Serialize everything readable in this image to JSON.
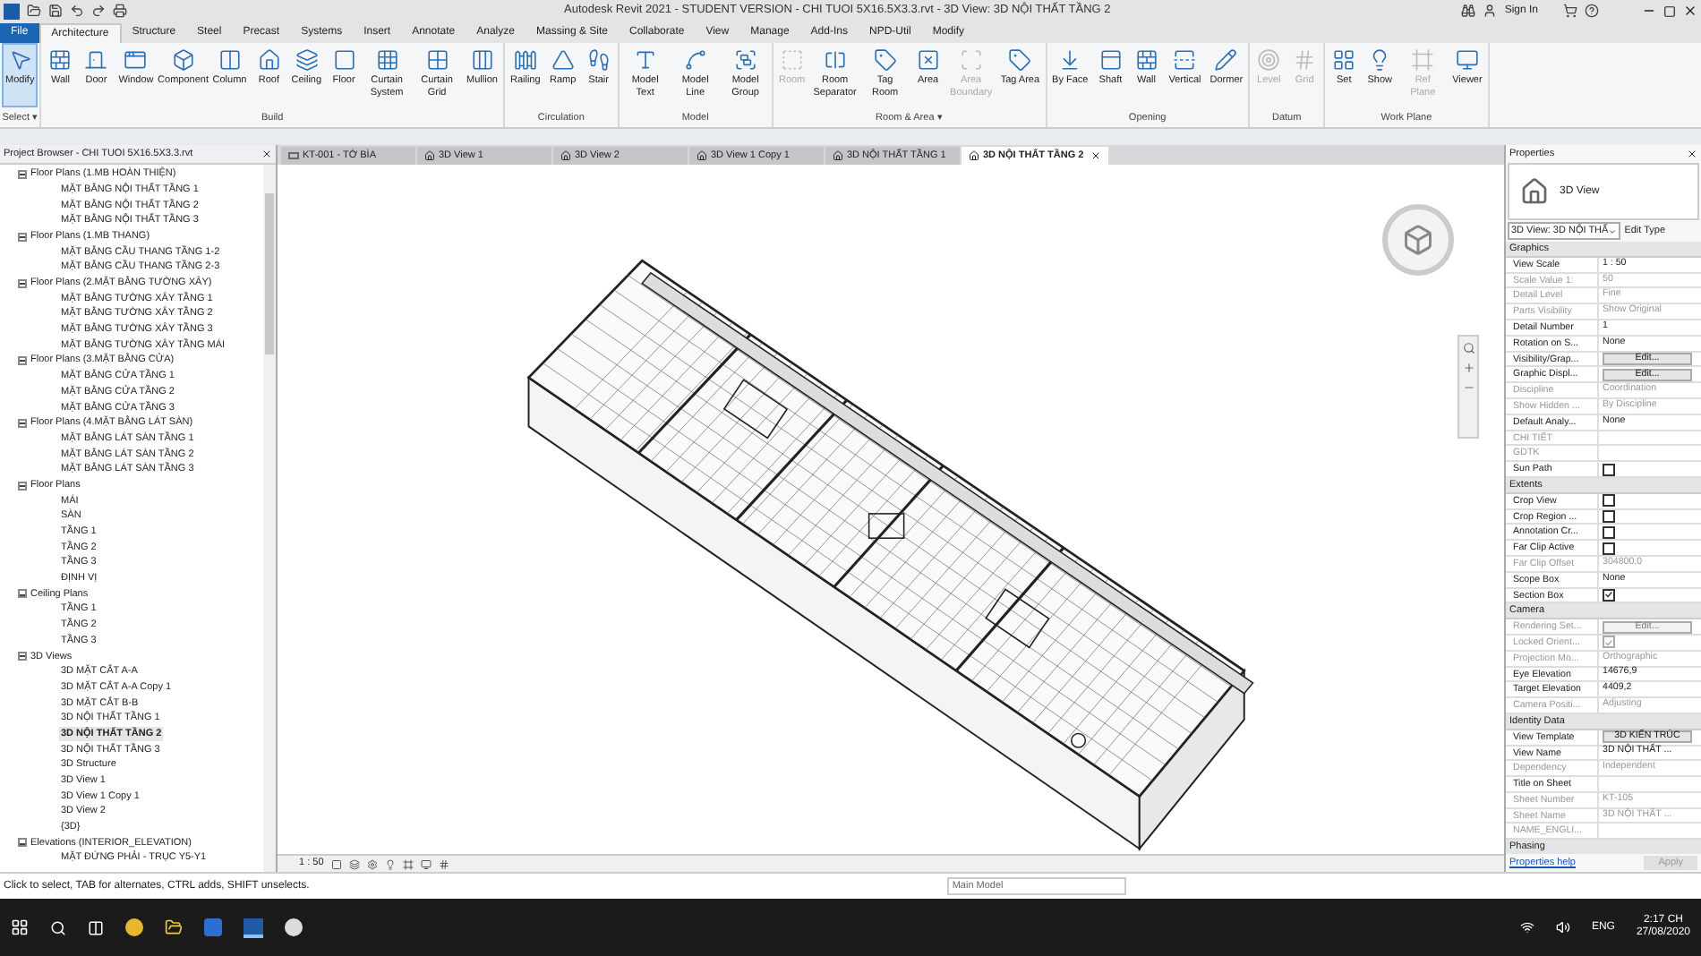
{
  "title_bar": {
    "title": "Autodesk Revit 2021 - STUDENT VERSION - CHI TUOI 5X16.5X3.3.rvt - 3D View: 3D NỘI THẤT TẦNG 2",
    "sign_in": "Sign In"
  },
  "file_tab": "File",
  "ribbon_tabs": [
    {
      "label": "Architecture",
      "selected": true
    },
    {
      "label": "Structure",
      "selected": false
    },
    {
      "label": "Steel",
      "selected": false
    },
    {
      "label": "Precast",
      "selected": false
    },
    {
      "label": "Systems",
      "selected": false
    },
    {
      "label": "Insert",
      "selected": false
    },
    {
      "label": "Annotate",
      "selected": false
    },
    {
      "label": "Analyze",
      "selected": false
    },
    {
      "label": "Massing & Site",
      "selected": false
    },
    {
      "label": "Collaborate",
      "selected": false
    },
    {
      "label": "View",
      "selected": false
    },
    {
      "label": "Manage",
      "selected": false
    },
    {
      "label": "Add-Ins",
      "selected": false
    },
    {
      "label": "NPD-Util",
      "selected": false
    },
    {
      "label": "Modify",
      "selected": false
    }
  ],
  "ribbon_panels": [
    {
      "title": "Select ▾",
      "tools": [
        {
          "label": "Modify",
          "selected": true,
          "disabled": false
        }
      ]
    },
    {
      "title": "Build",
      "tools": [
        {
          "label": "Wall",
          "selected": false,
          "disabled": false
        },
        {
          "label": "Door",
          "selected": false,
          "disabled": false
        },
        {
          "label": "Window",
          "selected": false,
          "disabled": false
        },
        {
          "label": "Component",
          "selected": false,
          "disabled": false
        },
        {
          "label": "Column",
          "selected": false,
          "disabled": false
        },
        {
          "label": "Roof",
          "selected": false,
          "disabled": false
        },
        {
          "label": "Ceiling",
          "selected": false,
          "disabled": false
        },
        {
          "label": "Floor",
          "selected": false,
          "disabled": false
        },
        {
          "label": "Curtain System",
          "selected": false,
          "disabled": false
        },
        {
          "label": "Curtain Grid",
          "selected": false,
          "disabled": false
        },
        {
          "label": "Mullion",
          "selected": false,
          "disabled": false
        }
      ]
    },
    {
      "title": "Circulation",
      "tools": [
        {
          "label": "Railing",
          "selected": false,
          "disabled": false
        },
        {
          "label": "Ramp",
          "selected": false,
          "disabled": false
        },
        {
          "label": "Stair",
          "selected": false,
          "disabled": false
        }
      ]
    },
    {
      "title": "Model",
      "tools": [
        {
          "label": "Model Text",
          "selected": false,
          "disabled": false
        },
        {
          "label": "Model Line",
          "selected": false,
          "disabled": false
        },
        {
          "label": "Model Group",
          "selected": false,
          "disabled": false
        }
      ]
    },
    {
      "title": "Room & Area ▾",
      "tools": [
        {
          "label": "Room",
          "selected": false,
          "disabled": true
        },
        {
          "label": "Room Separator",
          "selected": false,
          "disabled": false
        },
        {
          "label": "Tag Room",
          "selected": false,
          "disabled": false
        },
        {
          "label": "Area",
          "selected": false,
          "disabled": false
        },
        {
          "label": "Area Boundary",
          "selected": false,
          "disabled": true
        },
        {
          "label": "Tag Area",
          "selected": false,
          "disabled": false
        }
      ]
    },
    {
      "title": "Opening",
      "tools": [
        {
          "label": "By Face",
          "selected": false,
          "disabled": false
        },
        {
          "label": "Shaft",
          "selected": false,
          "disabled": false
        },
        {
          "label": "Wall",
          "selected": false,
          "disabled": false
        },
        {
          "label": "Vertical",
          "selected": false,
          "disabled": false
        },
        {
          "label": "Dormer",
          "selected": false,
          "disabled": false
        }
      ]
    },
    {
      "title": "Datum",
      "tools": [
        {
          "label": "Level",
          "selected": false,
          "disabled": true
        },
        {
          "label": "Grid",
          "selected": false,
          "disabled": true
        }
      ]
    },
    {
      "title": "Work Plane",
      "tools": [
        {
          "label": "Set",
          "selected": false,
          "disabled": false
        },
        {
          "label": "Show",
          "selected": false,
          "disabled": false
        },
        {
          "label": "Ref Plane",
          "selected": false,
          "disabled": true
        },
        {
          "label": "Viewer",
          "selected": false,
          "disabled": false
        }
      ]
    }
  ],
  "project_browser": {
    "title": "Project Browser - CHI TUOI 5X16.5X3.3.rvt",
    "tree": [
      {
        "label": "Floor Plans (1.MB HOÀN THIỆN)",
        "children": [
          {
            "label": "MẶT BẰNG NỘI THẤT TẦNG 1",
            "selected": false
          },
          {
            "label": "MẶT BẰNG NỘI THẤT TẦNG 2",
            "selected": false
          },
          {
            "label": "MẶT BẰNG NỘI THẤT TẦNG 3",
            "selected": false
          }
        ]
      },
      {
        "label": "Floor Plans (1.MB THANG)",
        "children": [
          {
            "label": "MẶT BẰNG CẦU THANG TẦNG 1-2",
            "selected": false
          },
          {
            "label": "MẶT BẰNG CẦU THANG TẦNG 2-3",
            "selected": false
          }
        ]
      },
      {
        "label": "Floor Plans (2.MẶT BẰNG TƯỜNG XÂY)",
        "children": [
          {
            "label": "MẶT BẰNG TƯỜNG XÂY TẦNG 1",
            "selected": false
          },
          {
            "label": "MẶT BẰNG TƯỜNG XÂY TẦNG 2",
            "selected": false
          },
          {
            "label": "MẶT BẰNG TƯỜNG XÂY TẦNG 3",
            "selected": false
          },
          {
            "label": "MẶT BẰNG TƯỜNG XÂY TẦNG MÁI",
            "selected": false
          }
        ]
      },
      {
        "label": "Floor Plans (3.MẶT BẰNG CỬA)",
        "children": [
          {
            "label": "MẶT BẰNG CỬA TẦNG 1",
            "selected": false
          },
          {
            "label": "MẶT BẰNG CỬA TẦNG 2",
            "selected": false
          },
          {
            "label": "MẶT BẰNG CỬA TẦNG 3",
            "selected": false
          }
        ]
      },
      {
        "label": "Floor Plans (4.MẶT BẰNG LÁT SÀN)",
        "children": [
          {
            "label": "MẶT BẰNG LÁT SÀN TẦNG 1",
            "selected": false
          },
          {
            "label": "MẶT BẰNG LÁT SÀN TẦNG 2",
            "selected": false
          },
          {
            "label": "MẶT BẰNG LÁT SÀN TẦNG 3",
            "selected": false
          }
        ]
      },
      {
        "label": "Floor Plans",
        "children": [
          {
            "label": "MÁI",
            "selected": false
          },
          {
            "label": "SÀN",
            "selected": false
          },
          {
            "label": "TẦNG 1",
            "selected": false
          },
          {
            "label": "TẦNG 2",
            "selected": false
          },
          {
            "label": "TẦNG 3",
            "selected": false
          },
          {
            "label": "ĐỊNH VỊ",
            "selected": false
          }
        ]
      },
      {
        "label": "Ceiling Plans",
        "children": [
          {
            "label": "TẦNG 1",
            "selected": false
          },
          {
            "label": "TẦNG 2",
            "selected": false
          },
          {
            "label": "TẦNG 3",
            "selected": false
          }
        ]
      },
      {
        "label": "3D Views",
        "children": [
          {
            "label": "3D MẶT CẮT A-A",
            "selected": false
          },
          {
            "label": "3D MẶT CẮT A-A Copy 1",
            "selected": false
          },
          {
            "label": "3D MẶT CẮT B-B",
            "selected": false
          },
          {
            "label": "3D NỘI THẤT TẦNG 1",
            "selected": false
          },
          {
            "label": "3D NỘI THẤT TẦNG 2",
            "selected": true
          },
          {
            "label": "3D NỘI THẤT TẦNG 3",
            "selected": false
          },
          {
            "label": "3D Structure",
            "selected": false
          },
          {
            "label": "3D View 1",
            "selected": false
          },
          {
            "label": "3D View 1 Copy 1",
            "selected": false
          },
          {
            "label": "3D View 2",
            "selected": false
          },
          {
            "label": "{3D}",
            "selected": false
          }
        ]
      },
      {
        "label": "Elevations (INTERIOR_ELEVATION)",
        "children": [
          {
            "label": "MẶT ĐỨNG PHẢI - TRỤC Y5-Y1",
            "selected": false
          }
        ]
      }
    ]
  },
  "view_tabs": [
    {
      "label": "KT-001 - TỜ BÌA",
      "kind": "sheet",
      "selected": false
    },
    {
      "label": "3D View 1",
      "kind": "model",
      "selected": false
    },
    {
      "label": "3D View 2",
      "kind": "model",
      "selected": false
    },
    {
      "label": "3D View 1 Copy 1",
      "kind": "model",
      "selected": false
    },
    {
      "label": "3D NỘI THẤT TẦNG 1",
      "kind": "model",
      "selected": false
    },
    {
      "label": "3D NỘI THẤT TẦNG 2",
      "kind": "model",
      "selected": true
    }
  ],
  "view_scale": "1 : 50",
  "properties": {
    "title": "Properties",
    "type_name": "3D View",
    "view_selector": "3D View: 3D NỘI THẤ",
    "edit_type": "Edit Type",
    "sections": [
      {
        "title": "Graphics",
        "rows": [
          {
            "kind": "text",
            "label": "View Scale",
            "value": "1 : 50",
            "disabled": false
          },
          {
            "kind": "text",
            "label": "Scale Value    1:",
            "value": "50",
            "disabled": true
          },
          {
            "kind": "text",
            "label": "Detail Level",
            "value": "Fine",
            "disabled": true
          },
          {
            "kind": "text",
            "label": "Parts Visibility",
            "value": "Show Original",
            "disabled": true
          },
          {
            "kind": "text",
            "label": "Detail Number",
            "value": "1",
            "disabled": false
          },
          {
            "kind": "text",
            "label": "Rotation on S...",
            "value": "None",
            "disabled": false
          },
          {
            "kind": "button",
            "label": "Visibility/Grap...",
            "value": "Edit...",
            "disabled": false
          },
          {
            "kind": "button",
            "label": "Graphic Displ...",
            "value": "Edit...",
            "disabled": false
          },
          {
            "kind": "text",
            "label": "Discipline",
            "value": "Coordination",
            "disabled": true
          },
          {
            "kind": "text",
            "label": "Show Hidden ...",
            "value": "By Discipline",
            "disabled": true
          },
          {
            "kind": "text",
            "label": "Default Analy...",
            "value": "None",
            "disabled": false
          },
          {
            "kind": "text",
            "label": "CHI TIẾT",
            "disabled": true
          },
          {
            "kind": "text",
            "label": "GDTK",
            "disabled": true
          },
          {
            "kind": "checkbox",
            "label": "Sun Path",
            "checked": false,
            "disabled": false
          }
        ]
      },
      {
        "title": "Extents",
        "rows": [
          {
            "kind": "checkbox",
            "label": "Crop View",
            "checked": false,
            "disabled": false
          },
          {
            "kind": "checkbox",
            "label": "Crop Region ...",
            "checked": false,
            "disabled": false
          },
          {
            "kind": "checkbox",
            "label": "Annotation Cr...",
            "checked": false,
            "disabled": false
          },
          {
            "kind": "checkbox",
            "label": "Far Clip Active",
            "checked": false,
            "disabled": false
          },
          {
            "kind": "text",
            "label": "Far Clip Offset",
            "value": "304800,0",
            "disabled": true
          },
          {
            "kind": "text",
            "label": "Scope Box",
            "value": "None",
            "disabled": false
          },
          {
            "kind": "checkbox",
            "label": "Section Box",
            "checked": true,
            "disabled": false
          }
        ]
      },
      {
        "title": "Camera",
        "rows": [
          {
            "kind": "button",
            "label": "Rendering Set...",
            "value": "Edit...",
            "disabled": true
          },
          {
            "kind": "checkbox",
            "label": "Locked Orient...",
            "checked": true,
            "disabled": true
          },
          {
            "kind": "text",
            "label": "Projection Mo...",
            "value": "Orthographic",
            "disabled": true
          },
          {
            "kind": "text",
            "label": "Eye Elevation",
            "value": "14676,9",
            "disabled": false
          },
          {
            "kind": "text",
            "label": "Target Elevation",
            "value": "4409,2",
            "disabled": false
          },
          {
            "kind": "text",
            "label": "Camera Positi...",
            "value": "Adjusting",
            "disabled": true
          }
        ]
      },
      {
        "title": "Identity Data",
        "rows": [
          {
            "kind": "button",
            "label": "View Template",
            "value": "3D KIẾN TRÚC",
            "disabled": false
          },
          {
            "kind": "text",
            "label": "View Name",
            "value": "3D NỘI THẤT ...",
            "disabled": false
          },
          {
            "kind": "text",
            "label": "Dependency",
            "value": "Independent",
            "disabled": true
          },
          {
            "kind": "text",
            "label": "Title on Sheet",
            "disabled": false
          },
          {
            "kind": "text",
            "label": "Sheet Number",
            "value": "KT-105",
            "disabled": true
          },
          {
            "kind": "text",
            "label": "Sheet Name",
            "value": "3D NỘI THẤT ...",
            "disabled": true
          },
          {
            "kind": "text",
            "label": "NAME_ENGLI...",
            "disabled": true
          }
        ]
      },
      {
        "title": "Phasing"
      }
    ],
    "help_link": "Properties help",
    "apply": "Apply"
  },
  "status_bar": {
    "message": "Click to select, TAB for alternates, CTRL adds, SHIFT unselects.",
    "model": "Main Model"
  },
  "taskbar": {
    "language": "ENG",
    "time": "2:17 CH",
    "date": "27/08/2020"
  }
}
